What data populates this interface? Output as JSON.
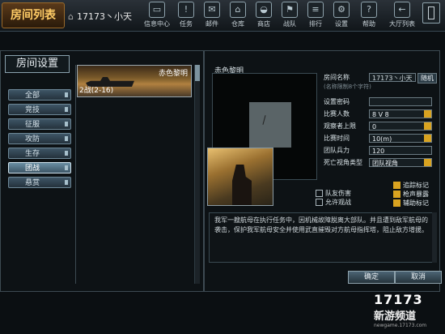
{
  "topbar": {
    "title": "房间列表",
    "user": "17173丶小天",
    "nav": [
      {
        "label": "信息中心",
        "icon": "monitor-icon"
      },
      {
        "label": "任务",
        "icon": "alert-icon"
      },
      {
        "label": "邮件",
        "icon": "mail-icon"
      },
      {
        "label": "仓库",
        "icon": "home-icon"
      },
      {
        "label": "商店",
        "icon": "bag-icon"
      },
      {
        "label": "战队",
        "icon": "group-icon"
      },
      {
        "label": "排行",
        "icon": "rank-icon"
      },
      {
        "label": "设置",
        "icon": "gear-icon"
      },
      {
        "label": "帮助",
        "icon": "help-icon"
      },
      {
        "label": "大厅列表",
        "icon": "back-icon"
      }
    ]
  },
  "settings": {
    "title": "房间设置",
    "modes": [
      "全部",
      "竞技",
      "征服",
      "攻防",
      "生存",
      "团战",
      "悬赏"
    ],
    "active_mode": "团战"
  },
  "map": {
    "name": "赤色黎明",
    "players": "2战(2-16)",
    "preview_name": "赤色黎明"
  },
  "form": {
    "room_name_label": "房间名称",
    "room_name": "17173丶小天",
    "random": "随机",
    "hint": "(名称限制8个字符)",
    "password_label": "设置密码",
    "player_count_label": "比赛人数",
    "player_count": "8 V 8",
    "observer_label": "观察者上限",
    "observer": "0",
    "time_label": "比赛时间",
    "time": "10(m)",
    "strength_label": "团队兵力",
    "strength": "120",
    "death_view_label": "死亡视角类型",
    "death_view": "团队视角"
  },
  "checks": {
    "friendly_fire": "队友伤害",
    "allow_observe": "允许观战",
    "track_mark": "追踪标记",
    "gunfire_expose": "枪声暴露",
    "assist_mark": "辅助标记"
  },
  "description": "我军一艘航母在执行任务中，因机械故障脱离大部队。并且遭到敌军航母的袭击，保护我军航母安全并使用武直摧毁对方航母指挥塔，阻止敌方增援。",
  "buttons": {
    "confirm": "确定",
    "cancel": "取消"
  },
  "logo": {
    "big": "17173",
    "small": "新游频道",
    "url": "newgame.17173.com"
  }
}
